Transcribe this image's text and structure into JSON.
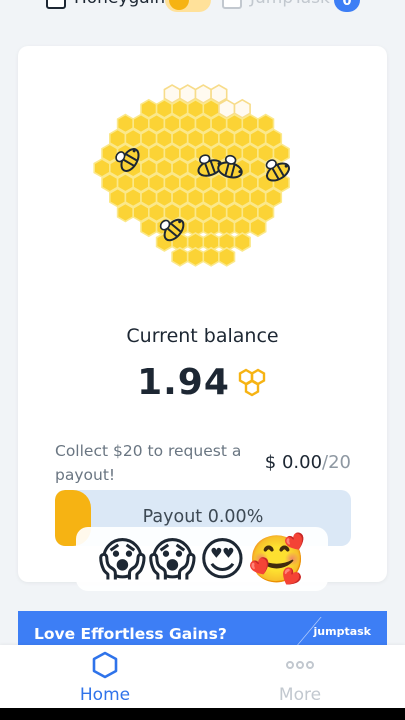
{
  "topbar": {
    "apps": [
      {
        "name": "Honeygain",
        "icon": "wallet-icon",
        "active": true
      },
      {
        "name": "JumpTask",
        "icon": "wallet-icon",
        "active": false
      }
    ],
    "jumptask_badge": "0",
    "colors": {
      "toggle_bg": "#ffe19a",
      "toggle_knob": "#f6b313",
      "badge": "#3d7ef5"
    }
  },
  "card": {
    "illustration": "honeycomb-with-bees",
    "balance_label": "Current balance",
    "balance_value": "1.94",
    "balance_icon": "honeycomb-icon",
    "collect_text": "Collect $20 to request a payout!",
    "payout_current": "$ 0.00",
    "payout_goal": "/20",
    "progress_label": "Payout 0.00%",
    "progress_fraction": 0.0,
    "colors": {
      "honey": "#f6b313",
      "progress_bg": "#dbe8f6"
    }
  },
  "reactions": [
    "😱",
    "😱",
    "😍",
    "🥰"
  ],
  "promo": {
    "text": "Love Effortless Gains?",
    "logo": "jumptask",
    "color": "#3d7ef5"
  },
  "nav": {
    "home_label": "Home",
    "more_label": "More",
    "home_icon": "hexagon-icon",
    "more_icon": "more-dots-icon",
    "active_color": "#2f73ea"
  }
}
